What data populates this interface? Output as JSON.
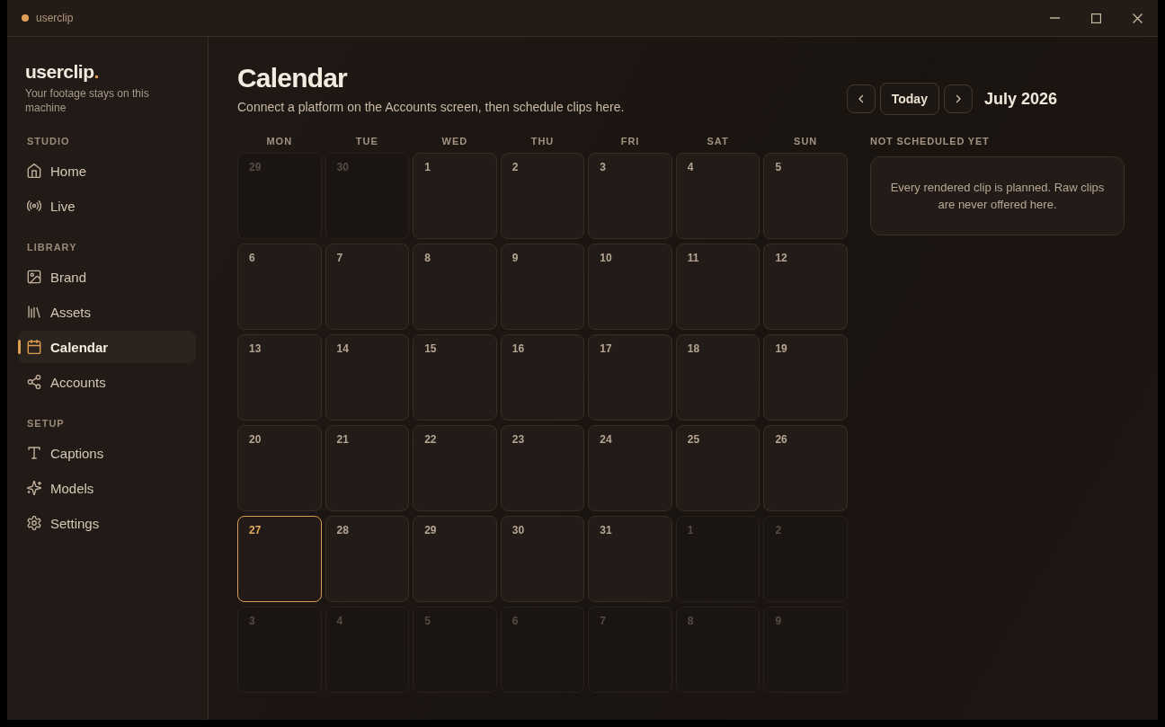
{
  "window": {
    "title": "userclip"
  },
  "sidebar": {
    "logo": {
      "name": "userclip",
      "dot": "."
    },
    "tagline": "Your footage stays on this machine",
    "sections": [
      {
        "label": "STUDIO",
        "items": [
          {
            "label": "Home",
            "selected": false
          },
          {
            "label": "Live",
            "selected": false
          }
        ]
      },
      {
        "label": "LIBRARY",
        "items": [
          {
            "label": "Brand",
            "selected": false
          },
          {
            "label": "Assets",
            "selected": false
          },
          {
            "label": "Calendar",
            "selected": true
          },
          {
            "label": "Accounts",
            "selected": false
          }
        ]
      },
      {
        "label": "SETUP",
        "items": [
          {
            "label": "Captions",
            "selected": false
          },
          {
            "label": "Models",
            "selected": false
          },
          {
            "label": "Settings",
            "selected": false
          }
        ]
      }
    ]
  },
  "header": {
    "title": "Calendar",
    "subtitle": "Connect a platform on the Accounts screen, then schedule clips here.",
    "today_button": "Today",
    "month": "July 2026"
  },
  "calendar": {
    "weekdays": [
      "MON",
      "TUE",
      "WED",
      "THU",
      "FRI",
      "SAT",
      "SUN"
    ],
    "days": [
      {
        "label": "29",
        "in_month": false,
        "today": false
      },
      {
        "label": "30",
        "in_month": false,
        "today": false
      },
      {
        "label": "1",
        "in_month": true,
        "today": false
      },
      {
        "label": "2",
        "in_month": true,
        "today": false
      },
      {
        "label": "3",
        "in_month": true,
        "today": false
      },
      {
        "label": "4",
        "in_month": true,
        "today": false
      },
      {
        "label": "5",
        "in_month": true,
        "today": false
      },
      {
        "label": "6",
        "in_month": true,
        "today": false
      },
      {
        "label": "7",
        "in_month": true,
        "today": false
      },
      {
        "label": "8",
        "in_month": true,
        "today": false
      },
      {
        "label": "9",
        "in_month": true,
        "today": false
      },
      {
        "label": "10",
        "in_month": true,
        "today": false
      },
      {
        "label": "11",
        "in_month": true,
        "today": false
      },
      {
        "label": "12",
        "in_month": true,
        "today": false
      },
      {
        "label": "13",
        "in_month": true,
        "today": false
      },
      {
        "label": "14",
        "in_month": true,
        "today": false
      },
      {
        "label": "15",
        "in_month": true,
        "today": false
      },
      {
        "label": "16",
        "in_month": true,
        "today": false
      },
      {
        "label": "17",
        "in_month": true,
        "today": false
      },
      {
        "label": "18",
        "in_month": true,
        "today": false
      },
      {
        "label": "19",
        "in_month": true,
        "today": false
      },
      {
        "label": "20",
        "in_month": true,
        "today": false
      },
      {
        "label": "21",
        "in_month": true,
        "today": false
      },
      {
        "label": "22",
        "in_month": true,
        "today": false
      },
      {
        "label": "23",
        "in_month": true,
        "today": false
      },
      {
        "label": "24",
        "in_month": true,
        "today": false
      },
      {
        "label": "25",
        "in_month": true,
        "today": false
      },
      {
        "label": "26",
        "in_month": true,
        "today": false
      },
      {
        "label": "27",
        "in_month": true,
        "today": true
      },
      {
        "label": "28",
        "in_month": true,
        "today": false
      },
      {
        "label": "29",
        "in_month": true,
        "today": false
      },
      {
        "label": "30",
        "in_month": true,
        "today": false
      },
      {
        "label": "31",
        "in_month": true,
        "today": false
      },
      {
        "label": "1",
        "in_month": false,
        "today": false
      },
      {
        "label": "2",
        "in_month": false,
        "today": false
      },
      {
        "label": "3",
        "in_month": false,
        "today": false
      },
      {
        "label": "4",
        "in_month": false,
        "today": false
      },
      {
        "label": "5",
        "in_month": false,
        "today": false
      },
      {
        "label": "6",
        "in_month": false,
        "today": false
      },
      {
        "label": "7",
        "in_month": false,
        "today": false
      },
      {
        "label": "8",
        "in_month": false,
        "today": false
      },
      {
        "label": "9",
        "in_month": false,
        "today": false
      }
    ]
  },
  "unscheduled": {
    "title": "NOT SCHEDULED YET",
    "message": "Every rendered clip is planned. Raw clips are never offered here."
  }
}
